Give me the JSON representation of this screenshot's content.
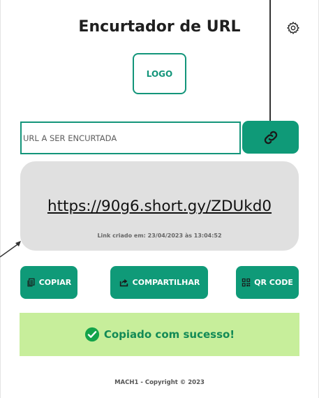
{
  "app": {
    "title": "Encurtador de URL",
    "logo_label": "LOGO"
  },
  "form": {
    "input_value": "",
    "input_placeholder": "URL A SER ENCURTADA",
    "shorten_icon": "link-icon"
  },
  "result": {
    "short_url": "https://90g6.short.gy/ZDUkd0",
    "created_at": "Link criado em: 23/04/2023 às 13:04:52"
  },
  "actions": {
    "copy_label": "COPIAR",
    "share_label": "COMPARTILHAR",
    "qr_label": "QR CODE"
  },
  "toast": {
    "message": "Copiado com sucesso!",
    "icon": "check-circle-icon"
  },
  "footer": {
    "text": "MACH1 - Copyright © 2023"
  },
  "colors": {
    "accent": "#0f9a78",
    "card": "#e0e0e0",
    "toast_bg": "#c7ee9b",
    "toast_text": "#128a56"
  }
}
